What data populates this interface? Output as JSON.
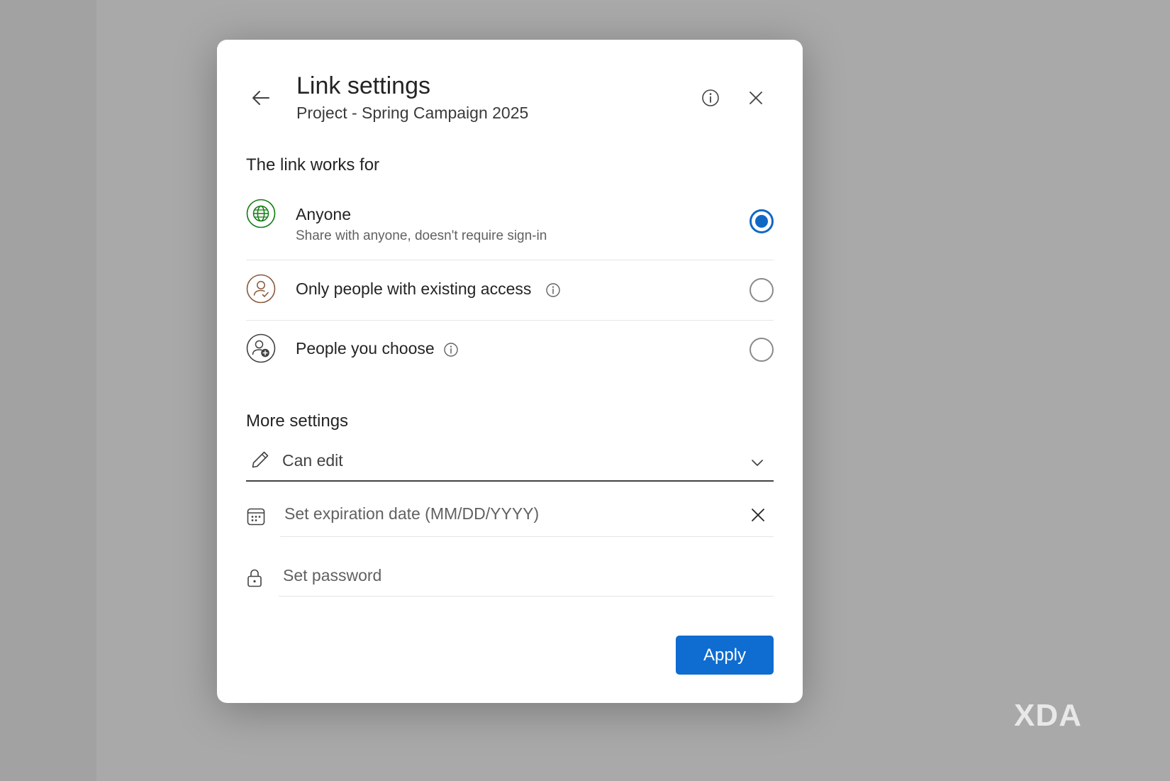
{
  "dialog": {
    "title": "Link settings",
    "subtitle": "Project - Spring Campaign 2025",
    "back_icon": "arrow-left-icon",
    "info_icon": "info-icon",
    "close_icon": "close-icon"
  },
  "link_works_for": {
    "heading": "The link works for",
    "options": [
      {
        "label": "Anyone",
        "description": "Share with anyone, doesn't require sign-in",
        "icon": "globe-icon",
        "selected": true
      },
      {
        "label": "Only people with existing access",
        "icon": "person-check-icon",
        "selected": false
      },
      {
        "label": "People you choose",
        "icon": "person-add-icon",
        "selected": false
      }
    ]
  },
  "more_settings": {
    "heading": "More settings",
    "permission": {
      "value": "Can edit",
      "icon": "pencil-icon"
    },
    "expiration": {
      "placeholder": "Set expiration date (MM/DD/YYYY)",
      "icon": "calendar-icon"
    },
    "password": {
      "placeholder": "Set password",
      "icon": "lock-icon"
    }
  },
  "apply_label": "Apply",
  "watermark": "XDA",
  "colors": {
    "accent": "#0f6cd0",
    "globe": "#107c10",
    "person": "#8a5a3c"
  }
}
